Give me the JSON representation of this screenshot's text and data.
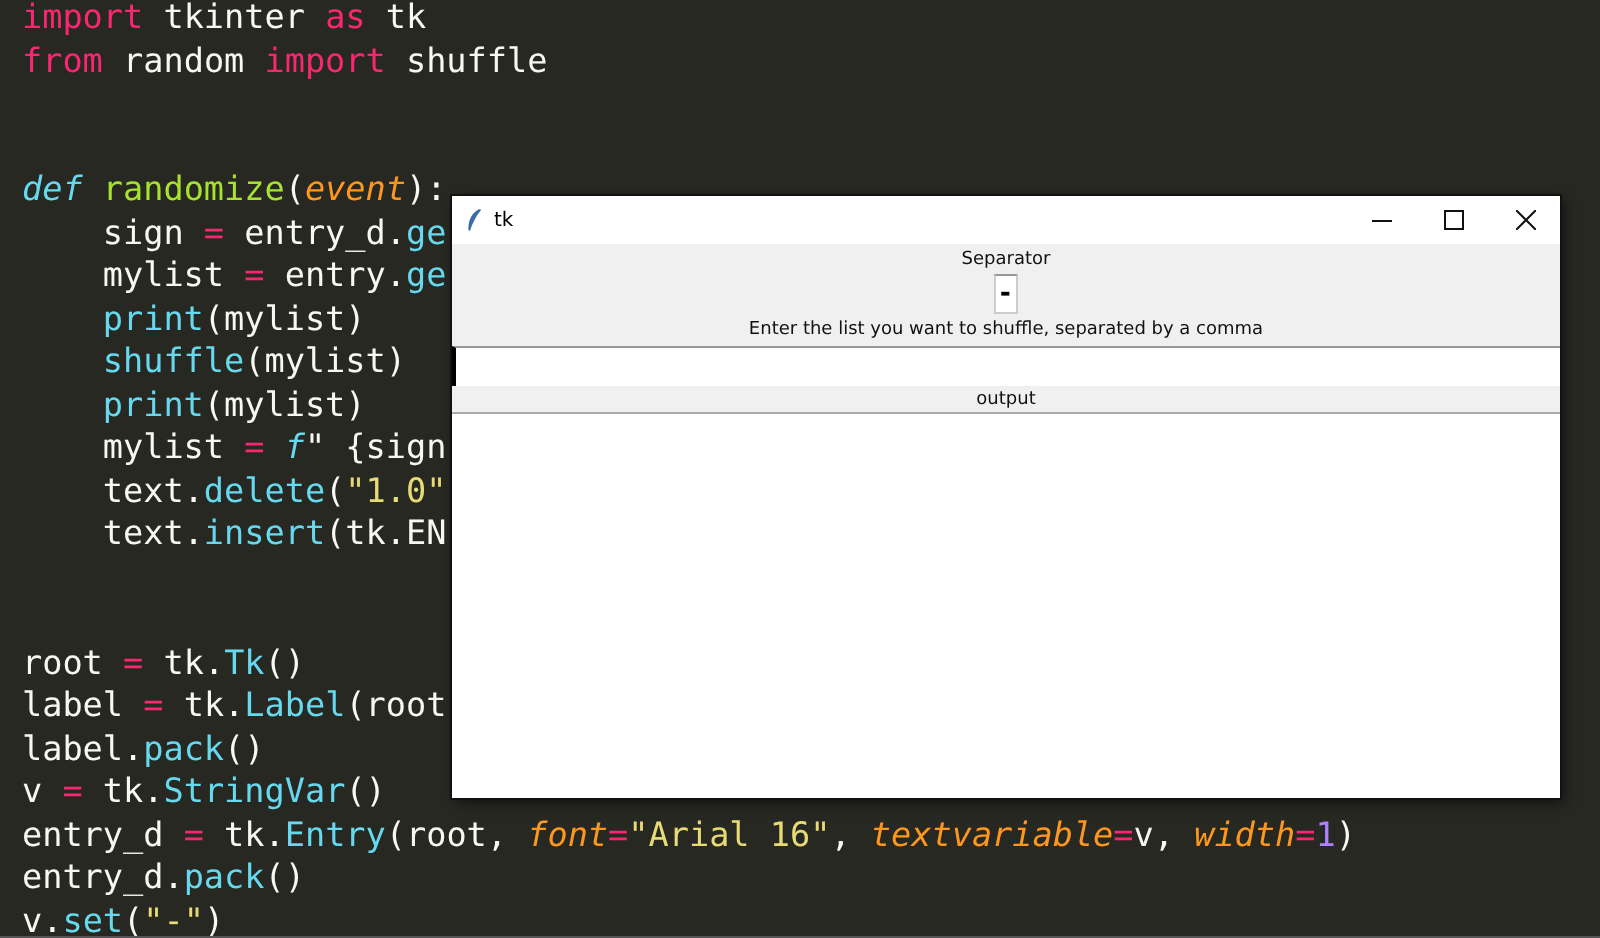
{
  "editor": {
    "lines": [
      {
        "kind": "code",
        "indented": false,
        "tokens": [
          {
            "t": "import",
            "kind": "kw"
          },
          {
            "t": " tkinter ",
            "kind": "plain"
          },
          {
            "t": "as",
            "kind": "kw"
          },
          {
            "t": " tk",
            "kind": "plain"
          }
        ]
      },
      {
        "kind": "code",
        "indented": false,
        "tokens": [
          {
            "t": "from",
            "kind": "kw"
          },
          {
            "t": " random ",
            "kind": "plain"
          },
          {
            "t": "import",
            "kind": "kw"
          },
          {
            "t": " shuffle",
            "kind": "plain"
          }
        ]
      },
      {
        "kind": "blank"
      },
      {
        "kind": "blank"
      },
      {
        "kind": "code",
        "indented": false,
        "tokens": [
          {
            "t": "def",
            "kind": "storage"
          },
          {
            "t": " randomize",
            "kind": "fn"
          },
          {
            "t": "(",
            "kind": "plain"
          },
          {
            "t": "event",
            "kind": "param"
          },
          {
            "t": "):",
            "kind": "plain"
          }
        ]
      },
      {
        "kind": "code",
        "indented": true,
        "tokens": [
          {
            "t": "sign ",
            "kind": "plain"
          },
          {
            "t": "=",
            "kind": "op"
          },
          {
            "t": " entry_d.",
            "kind": "plain"
          },
          {
            "t": "ge",
            "kind": "builtin"
          }
        ]
      },
      {
        "kind": "code",
        "indented": true,
        "tokens": [
          {
            "t": "mylist ",
            "kind": "plain"
          },
          {
            "t": "=",
            "kind": "op"
          },
          {
            "t": " entry.",
            "kind": "plain"
          },
          {
            "t": "ge",
            "kind": "builtin"
          }
        ]
      },
      {
        "kind": "code",
        "indented": true,
        "tokens": [
          {
            "t": "print",
            "kind": "builtin"
          },
          {
            "t": "(mylist)",
            "kind": "plain"
          }
        ]
      },
      {
        "kind": "code",
        "indented": true,
        "tokens": [
          {
            "t": "shuffle",
            "kind": "builtin"
          },
          {
            "t": "(mylist)",
            "kind": "plain"
          }
        ]
      },
      {
        "kind": "code",
        "indented": true,
        "tokens": [
          {
            "t": "print",
            "kind": "builtin"
          },
          {
            "t": "(mylist)",
            "kind": "plain"
          }
        ]
      },
      {
        "kind": "code",
        "indented": true,
        "tokens": [
          {
            "t": "mylist ",
            "kind": "plain"
          },
          {
            "t": "=",
            "kind": "op"
          },
          {
            "t": " f",
            "kind": "storage"
          },
          {
            "t": "\" {sign",
            "kind": "plain"
          }
        ]
      },
      {
        "kind": "code",
        "indented": true,
        "tokens": [
          {
            "t": "text.",
            "kind": "plain"
          },
          {
            "t": "delete",
            "kind": "builtin"
          },
          {
            "t": "(",
            "kind": "plain"
          },
          {
            "t": "\"1.0\"",
            "kind": "str"
          }
        ]
      },
      {
        "kind": "code",
        "indented": true,
        "tokens": [
          {
            "t": "text.",
            "kind": "plain"
          },
          {
            "t": "insert",
            "kind": "builtin"
          },
          {
            "t": "(tk.EN",
            "kind": "plain"
          }
        ]
      },
      {
        "kind": "blank"
      },
      {
        "kind": "blank"
      },
      {
        "kind": "code",
        "indented": false,
        "tokens": [
          {
            "t": "root ",
            "kind": "plain"
          },
          {
            "t": "=",
            "kind": "op"
          },
          {
            "t": " tk.",
            "kind": "plain"
          },
          {
            "t": "Tk",
            "kind": "builtin"
          },
          {
            "t": "()",
            "kind": "plain"
          }
        ]
      },
      {
        "kind": "code",
        "indented": false,
        "tokens": [
          {
            "t": "label ",
            "kind": "plain"
          },
          {
            "t": "=",
            "kind": "op"
          },
          {
            "t": " tk.",
            "kind": "plain"
          },
          {
            "t": "Label",
            "kind": "builtin"
          },
          {
            "t": "(root",
            "kind": "plain"
          }
        ]
      },
      {
        "kind": "code",
        "indented": false,
        "tokens": [
          {
            "t": "label.",
            "kind": "plain"
          },
          {
            "t": "pack",
            "kind": "builtin"
          },
          {
            "t": "()",
            "kind": "plain"
          }
        ]
      },
      {
        "kind": "code",
        "indented": false,
        "tokens": [
          {
            "t": "v ",
            "kind": "plain"
          },
          {
            "t": "=",
            "kind": "op"
          },
          {
            "t": " tk.",
            "kind": "plain"
          },
          {
            "t": "StringVar",
            "kind": "builtin"
          },
          {
            "t": "()",
            "kind": "plain"
          }
        ]
      },
      {
        "kind": "code",
        "indented": false,
        "tokens": [
          {
            "t": "entry_d ",
            "kind": "plain"
          },
          {
            "t": "=",
            "kind": "op"
          },
          {
            "t": " tk.",
            "kind": "plain"
          },
          {
            "t": "Entry",
            "kind": "builtin"
          },
          {
            "t": "(root, ",
            "kind": "plain"
          },
          {
            "t": "font",
            "kind": "param"
          },
          {
            "t": "=",
            "kind": "op"
          },
          {
            "t": "\"Arial 16\"",
            "kind": "str"
          },
          {
            "t": ", ",
            "kind": "plain"
          },
          {
            "t": "textvariable",
            "kind": "param"
          },
          {
            "t": "=",
            "kind": "op"
          },
          {
            "t": "v, ",
            "kind": "plain"
          },
          {
            "t": "width",
            "kind": "param"
          },
          {
            "t": "=",
            "kind": "op"
          },
          {
            "t": "1",
            "kind": "num"
          },
          {
            "t": ")",
            "kind": "plain"
          }
        ]
      },
      {
        "kind": "code",
        "indented": false,
        "tokens": [
          {
            "t": "entry_d.",
            "kind": "plain"
          },
          {
            "t": "pack",
            "kind": "builtin"
          },
          {
            "t": "()",
            "kind": "plain"
          }
        ]
      },
      {
        "kind": "code",
        "indented": false,
        "tokens": [
          {
            "t": "v.",
            "kind": "plain"
          },
          {
            "t": "set",
            "kind": "builtin"
          },
          {
            "t": "(",
            "kind": "plain"
          },
          {
            "t": "\"-\"",
            "kind": "str"
          },
          {
            "t": ")",
            "kind": "plain"
          }
        ]
      }
    ]
  },
  "window": {
    "title": "tk",
    "separator_label": "Separator",
    "separator_value": "-",
    "prompt": "Enter the list you want to shuffle, separated by a comma",
    "list_focused": true,
    "output_label": "output"
  }
}
